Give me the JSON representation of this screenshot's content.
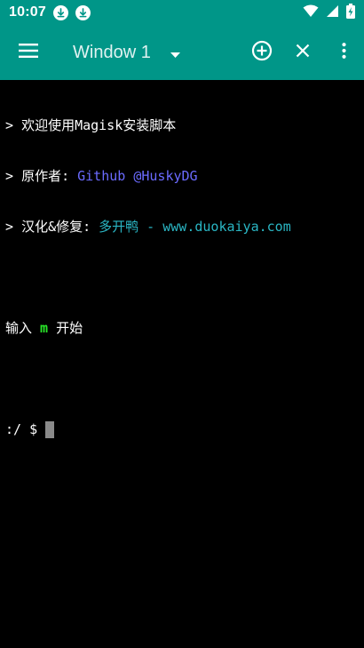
{
  "status_bar": {
    "time": "10:07",
    "download_icon_color": "#009688"
  },
  "toolbar": {
    "window_title": "Window 1",
    "icons": [
      "menu-icon",
      "dropdown-arrow-icon",
      "add-circle-icon",
      "close-icon",
      "more-vert-icon"
    ]
  },
  "terminal": {
    "line1": {
      "prompt": "> ",
      "text": "欢迎使用Magisk安装脚本"
    },
    "line2": {
      "prompt": "> ",
      "label": "原作者: ",
      "author": "Github @HuskyDG"
    },
    "line3": {
      "prompt": "> ",
      "label": "汉化&修复: ",
      "credit": "多开鸭 - www.duokaiya.com"
    },
    "line4": {
      "before": "输入 ",
      "key": "m",
      "after": " 开始"
    },
    "shell_prompt": ":/ $ "
  },
  "colors": {
    "teal": "#009688",
    "author_blue": "#6b6bff",
    "credit_cyan": "#2ab6c4",
    "key_green": "#29e829",
    "cursor_gray": "#8a8a8a"
  }
}
